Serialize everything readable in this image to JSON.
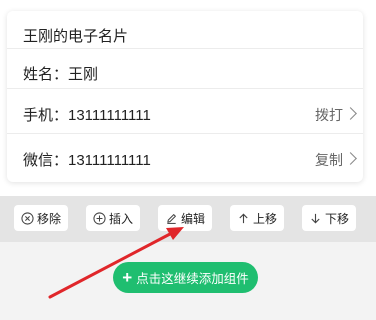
{
  "card": {
    "title": "王刚的电子名片",
    "name_row": {
      "label": "姓名：王刚"
    },
    "phone_row": {
      "label": "手机：13111111111",
      "action": "拨打"
    },
    "wechat_row": {
      "label": "微信：13111111111",
      "action": "复制"
    }
  },
  "toolbar": {
    "remove_label": "移除",
    "insert_label": "插入",
    "edit_label": "编辑",
    "move_up_label": "上移",
    "move_down_label": "下移"
  },
  "add_component": {
    "label": "点击这继续添加组件"
  },
  "colors": {
    "accent_green": "#1fbe70",
    "annotation_arrow": "#e0262a"
  }
}
